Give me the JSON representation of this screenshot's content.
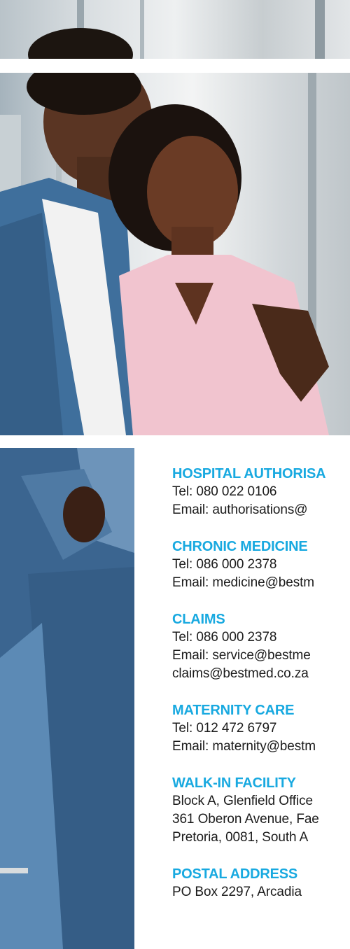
{
  "colors": {
    "heading": "#18a9e0",
    "text": "#1b1b1b"
  },
  "photo": {
    "description_icon": "couple-photo"
  },
  "contacts": [
    {
      "title": "HOSPITAL AUTHORISA",
      "lines": [
        "Tel: 080 022 0106",
        "Email: authorisations@"
      ]
    },
    {
      "title": "CHRONIC MEDICINE",
      "lines": [
        "Tel: 086 000 2378",
        "Email: medicine@bestm"
      ]
    },
    {
      "title": "CLAIMS",
      "lines": [
        "Tel: 086 000 2378",
        "Email: service@bestme",
        "claims@bestmed.co.za"
      ]
    },
    {
      "title": "MATERNITY CARE",
      "lines": [
        "Tel: 012 472 6797",
        "Email: maternity@bestm"
      ]
    },
    {
      "title": "WALK-IN FACILITY",
      "lines": [
        "Block A, Glenfield Office",
        "361 Oberon Avenue, Fae",
        "Pretoria, 0081, South A"
      ]
    },
    {
      "title": "POSTAL ADDRESS",
      "lines": [
        "PO Box 2297, Arcadia"
      ]
    }
  ]
}
